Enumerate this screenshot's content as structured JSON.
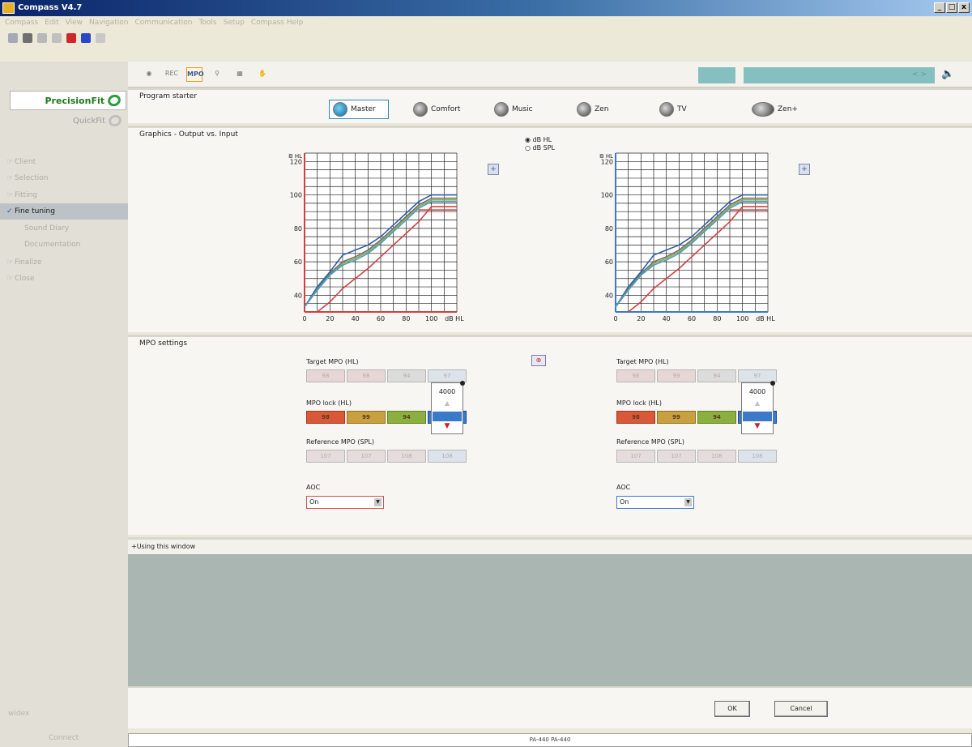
{
  "window": {
    "title": "Compass V4.7",
    "minimize": "_",
    "maximize": "□",
    "close": "x"
  },
  "menu": [
    "Compass",
    "Edit",
    "View",
    "Navigation",
    "Communication",
    "Tools",
    "Setup",
    "Compass Help"
  ],
  "sidebar": {
    "precisionfit": "PrecisionFit",
    "quickfit": "QuickFit",
    "nav": [
      {
        "label": "Client",
        "check": "☞"
      },
      {
        "label": "Selection",
        "check": "☞"
      },
      {
        "label": "Fitting",
        "check": "☞"
      },
      {
        "label": "Fine tuning",
        "check": "✓"
      },
      {
        "label": "Sound Diary",
        "check": ""
      },
      {
        "label": "Documentation",
        "check": ""
      },
      {
        "label": "Finalize",
        "check": "☞"
      },
      {
        "label": "Close",
        "check": "☞"
      }
    ],
    "footer": "widex",
    "footer2": "Connect"
  },
  "toolbar2": {
    "mpo": "MPO",
    "rec": "REC",
    "teal_text": "< >"
  },
  "program_starter": {
    "title": "Program starter",
    "programs": [
      "Master",
      "Comfort",
      "Music",
      "Zen",
      "TV",
      "Zen+"
    ]
  },
  "graphics": {
    "title": "Graphics - Output vs. Input",
    "units": {
      "hl": "dB HL",
      "spl": "dB SPL"
    },
    "help_label": "+"
  },
  "chart_data": [
    {
      "type": "line",
      "title": "",
      "xlabel": "dB HL",
      "ylabel": "dB HL",
      "xlim": [
        0,
        120
      ],
      "ylim": [
        30,
        125
      ],
      "x_ticks": [
        0,
        20,
        40,
        60,
        80,
        100
      ],
      "y_ticks": [
        40,
        60,
        80,
        100,
        120
      ],
      "series": [
        {
          "color": "#2e5fa8",
          "x": [
            0,
            10,
            20,
            30,
            40,
            50,
            60,
            70,
            80,
            90,
            100,
            120
          ],
          "y": [
            33,
            45,
            54,
            64,
            67,
            70,
            75,
            82,
            89,
            96,
            100,
            100
          ]
        },
        {
          "color": "#707070",
          "x": [
            0,
            10,
            20,
            30,
            40,
            50,
            60,
            70,
            80,
            90,
            100,
            120
          ],
          "y": [
            33,
            44,
            53,
            60,
            63,
            67,
            73,
            80,
            87,
            94,
            98,
            98
          ]
        },
        {
          "color": "#9aa84a",
          "x": [
            0,
            10,
            20,
            30,
            40,
            50,
            60,
            70,
            80,
            90,
            100,
            120
          ],
          "y": [
            33,
            43,
            52,
            59,
            62,
            66,
            72,
            79,
            86,
            93,
            97,
            97
          ]
        },
        {
          "color": "#44a0c8",
          "x": [
            0,
            10,
            20,
            30,
            40,
            50,
            60,
            70,
            80,
            90,
            100,
            120
          ],
          "y": [
            33,
            43,
            52,
            58,
            61,
            65,
            71,
            78,
            85,
            92,
            96,
            96
          ]
        },
        {
          "color": "#d04040",
          "x": [
            10,
            20,
            30,
            40,
            50,
            60,
            70,
            80,
            90,
            100,
            120
          ],
          "y": [
            30,
            36,
            44,
            50,
            56,
            63,
            70,
            77,
            84,
            93,
            93
          ]
        },
        {
          "color": "#d04040",
          "x": [
            90,
            100,
            120
          ],
          "y": [
            91,
            91,
            91
          ]
        }
      ],
      "axis_color": "#d04040"
    },
    {
      "type": "line",
      "title": "",
      "xlabel": "dB HL",
      "ylabel": "dB HL",
      "xlim": [
        0,
        120
      ],
      "ylim": [
        30,
        125
      ],
      "x_ticks": [
        0,
        20,
        40,
        60,
        80,
        100
      ],
      "y_ticks": [
        40,
        60,
        80,
        100,
        120
      ],
      "series": [
        {
          "color": "#2e5fa8",
          "x": [
            0,
            10,
            20,
            30,
            40,
            50,
            60,
            70,
            80,
            90,
            100,
            120
          ],
          "y": [
            33,
            45,
            54,
            64,
            67,
            70,
            75,
            82,
            89,
            96,
            100,
            100
          ]
        },
        {
          "color": "#707070",
          "x": [
            0,
            10,
            20,
            30,
            40,
            50,
            60,
            70,
            80,
            90,
            100,
            120
          ],
          "y": [
            33,
            44,
            53,
            60,
            63,
            67,
            73,
            80,
            87,
            94,
            98,
            98
          ]
        },
        {
          "color": "#9aa84a",
          "x": [
            0,
            10,
            20,
            30,
            40,
            50,
            60,
            70,
            80,
            90,
            100,
            120
          ],
          "y": [
            33,
            43,
            52,
            59,
            62,
            66,
            72,
            79,
            86,
            93,
            97,
            97
          ]
        },
        {
          "color": "#44a0c8",
          "x": [
            0,
            10,
            20,
            30,
            40,
            50,
            60,
            70,
            80,
            90,
            100,
            120
          ],
          "y": [
            33,
            43,
            52,
            58,
            61,
            65,
            71,
            78,
            85,
            92,
            96,
            96
          ]
        },
        {
          "color": "#d04040",
          "x": [
            10,
            20,
            30,
            40,
            50,
            60,
            70,
            80,
            90,
            100,
            120
          ],
          "y": [
            30,
            36,
            44,
            50,
            56,
            63,
            70,
            77,
            84,
            93,
            93
          ]
        },
        {
          "color": "#d04040",
          "x": [
            90,
            100,
            120
          ],
          "y": [
            91,
            91,
            91
          ]
        }
      ],
      "axis_color": "#3a7ac8"
    }
  ],
  "mpo": {
    "title": "MPO settings",
    "target_label": "Target MPO (HL)",
    "lock_label": "MPO lock (HL)",
    "ref_label": "Reference MPO (SPL)",
    "aoc_label": "AOC",
    "left": {
      "target": [
        "98",
        "98",
        "94",
        "97"
      ],
      "lock": [
        "98",
        "99",
        "94",
        "97"
      ],
      "ref": [
        "107",
        "107",
        "108",
        "108"
      ],
      "aoc": "On",
      "freq": "4000"
    },
    "right": {
      "target": [
        "98",
        "99",
        "94",
        "97"
      ],
      "lock": [
        "98",
        "99",
        "94",
        "97"
      ],
      "ref": [
        "107",
        "107",
        "108",
        "108"
      ],
      "aoc": "On",
      "freq": "4000"
    }
  },
  "using_window": "+Using this window",
  "buttons": {
    "ok": "OK",
    "cancel": "Cancel"
  },
  "status": "PA-440   PA-440"
}
